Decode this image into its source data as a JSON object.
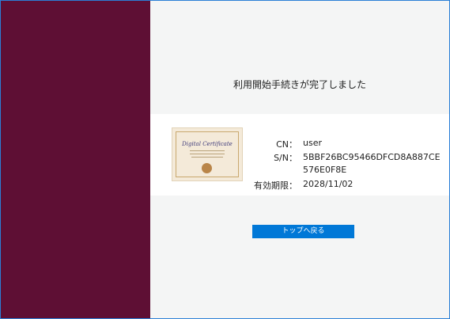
{
  "message": {
    "completed": "利用開始手続きが完了しました"
  },
  "certificate": {
    "image_text": "Digital Certificate",
    "cn_label": "CN：",
    "cn_value": "user",
    "sn_label": "S/N：",
    "sn_value": "5BBF26BC95466DFCD8A887CE576E0F8E",
    "expiry_label": "有効期限：",
    "expiry_value": "2028/11/02"
  },
  "actions": {
    "back_to_top_label": "トップへ戻る"
  },
  "colors": {
    "sidebar": "#5e0f34",
    "background": "#f4f5f5",
    "panel": "#ffffff",
    "button": "#0078d7",
    "window_border": "#2b7fd6"
  }
}
